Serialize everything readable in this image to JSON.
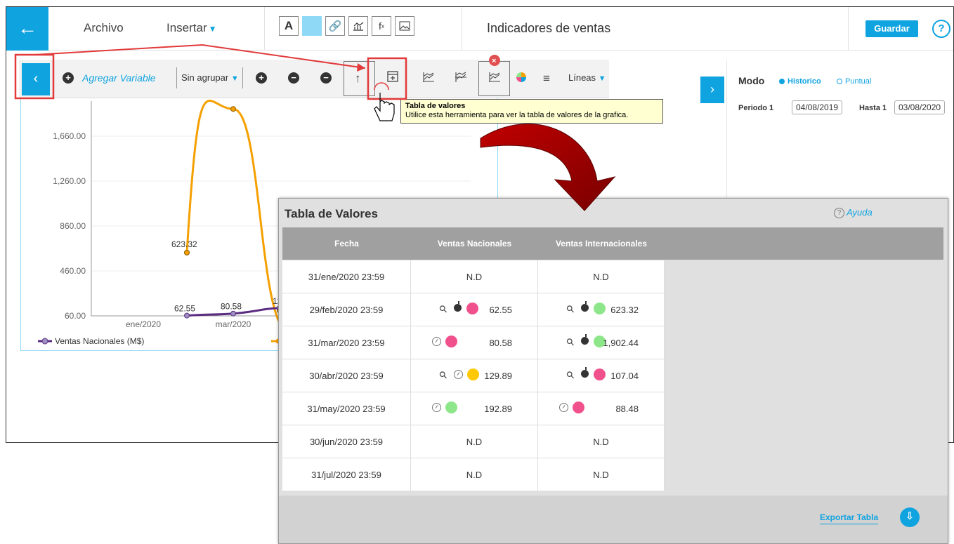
{
  "topbar": {
    "back_icon": "arrow-left-icon",
    "archivo": "Archivo",
    "insertar": "Insertar",
    "doc_title": "Indicadores de ventas",
    "save": "Guardar",
    "help": "?"
  },
  "chart_toolbar": {
    "agregar": "Agregar Variable",
    "sin_agrupar": "Sin agrupar",
    "lineas": "Líneas"
  },
  "chart_data": {
    "type": "line",
    "x_tick_labels": [
      "ene/2020",
      "mar/2020"
    ],
    "y_tick_labels": [
      "60.00",
      "460.00",
      "860.00",
      "1,260.00",
      "1,660.00"
    ],
    "ylim": [
      60,
      1902.44
    ],
    "series": [
      {
        "name": "Ventas Nacionales (M$)",
        "color": "#5a2d82",
        "values": [
          62.55,
          80.58,
          129.89
        ],
        "labels": [
          "62.55",
          "80.58",
          "129.89"
        ]
      },
      {
        "color": "#f5a000",
        "values": [
          623.32,
          1902.44,
          107.04
        ],
        "labels": [
          "623.32",
          "",
          ""
        ]
      }
    ],
    "legend": "bottom-left"
  },
  "right_panel": {
    "modo": "Modo",
    "historico": "Historico",
    "puntual": "Puntual",
    "periodo_label": "Periodo 1",
    "periodo_value": "04/08/2019",
    "hasta_label": "Hasta 1",
    "hasta_value": "03/08/2020"
  },
  "tooltip": {
    "title": "Tabla de valores",
    "text": "Utilice esta herramienta para ver la tabla de valores de la grafica."
  },
  "tabla": {
    "title": "Tabla de Valores",
    "help": "Ayuda",
    "headers": [
      "Fecha",
      "Ventas Nacionales",
      "Ventas Internacionales"
    ],
    "export": "Exportar Tabla",
    "colors": {
      "red": "#f0508c",
      "green": "#8ee68a",
      "yellow": "#ffc800"
    },
    "rows": [
      {
        "fecha": "31/ene/2020 23:59",
        "nac": {
          "value": "N.D"
        },
        "int": {
          "value": "N.D"
        }
      },
      {
        "fecha": "29/feb/2020 23:59",
        "nac": {
          "value": "62.55",
          "icons": [
            "magnifier-icon",
            "bomb-icon"
          ],
          "status": "red"
        },
        "int": {
          "value": "623.32",
          "icons": [
            "magnifier-icon",
            "bomb-icon"
          ],
          "status": "green"
        }
      },
      {
        "fecha": "31/mar/2020 23:59",
        "nac": {
          "value": "80.58",
          "icons": [
            "clock-icon"
          ],
          "status": "red"
        },
        "int": {
          "value": "1,902.44",
          "icons": [
            "magnifier-icon",
            "bomb-icon"
          ],
          "status": "green"
        }
      },
      {
        "fecha": "30/abr/2020 23:59",
        "nac": {
          "value": "129.89",
          "icons": [
            "magnifier-icon",
            "clock-icon"
          ],
          "status": "yellow"
        },
        "int": {
          "value": "107.04",
          "icons": [
            "magnifier-icon",
            "bomb-icon"
          ],
          "status": "red"
        }
      },
      {
        "fecha": "31/may/2020 23:59",
        "nac": {
          "value": "192.89",
          "icons": [
            "clock-icon"
          ],
          "status": "green"
        },
        "int": {
          "value": "88.48",
          "icons": [
            "clock-icon"
          ],
          "status": "red"
        }
      },
      {
        "fecha": "30/jun/2020 23:59",
        "nac": {
          "value": "N.D"
        },
        "int": {
          "value": "N.D"
        }
      },
      {
        "fecha": "31/jul/2020 23:59",
        "nac": {
          "value": "N.D"
        },
        "int": {
          "value": "N.D"
        }
      }
    ]
  }
}
